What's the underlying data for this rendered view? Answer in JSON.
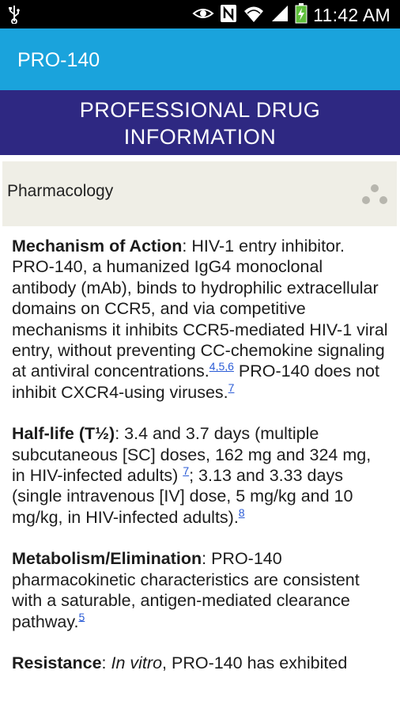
{
  "status_bar": {
    "time": "11:42 AM",
    "icons": [
      "usb-icon",
      "eye-icon",
      "nfc-icon",
      "wifi-icon",
      "signal-icon",
      "battery-charging-icon"
    ]
  },
  "app_bar": {
    "title": "PRO-140"
  },
  "banner": {
    "line1": "PROFESSIONAL DRUG",
    "line2": "INFORMATION"
  },
  "section": {
    "label": "Pharmacology",
    "menu_icon": "more-dots-icon"
  },
  "paragraphs": {
    "moa": {
      "heading": "Mechanism of Action",
      "text1": ": HIV-1 entry inhibitor. PRO-140, a humanized IgG4 monoclonal antibody (mAb), binds to hydrophilic extracellular domains on CCR5, and via competitive mechanisms it inhibits CCR5-mediated HIV-1 viral entry, without preventing CC-chemokine signaling at antiviral concentrations.",
      "ref1": "4,5,6",
      "text2": " PRO-140 does not inhibit CXCR4-using viruses.",
      "ref2": "7"
    },
    "halflife": {
      "heading": "Half-life (T½)",
      "text1": ": 3.4 and 3.7 days (multiple subcutaneous [SC] doses, 162 mg and 324 mg, in HIV-infected adults) ",
      "ref1": "7",
      "text2": "; 3.13 and 3.33 days (single intravenous [IV] dose, 5 mg/kg and 10 mg/kg, in HIV-infected adults).",
      "ref2": "8"
    },
    "metabolism": {
      "heading": "Metabolism/Elimination",
      "text1": ": PRO-140 pharmacokinetic characteristics are consistent with a saturable, antigen-mediated clearance pathway.",
      "ref1": "5"
    },
    "resistance": {
      "heading": "Resistance",
      "text1": ": ",
      "italic": "In vitro",
      "text2": ", PRO-140 has exhibited"
    }
  }
}
